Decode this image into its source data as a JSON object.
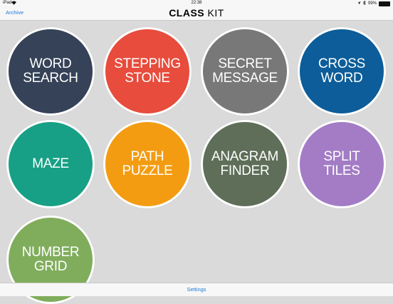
{
  "status": {
    "device": "iPad",
    "time": "22:38",
    "battery_text": "99%",
    "battery_level": 0.99
  },
  "nav": {
    "archive_label": "Archive",
    "title_bold": "CLASS",
    "title_light": "KIT"
  },
  "games": [
    {
      "label": "WORD\nSEARCH",
      "color": "#354257"
    },
    {
      "label": "STEPPING\nSTONE",
      "color": "#e74c3c"
    },
    {
      "label": "SECRET\nMESSAGE",
      "color": "#787878"
    },
    {
      "label": "CROSS\nWORD",
      "color": "#0c5d99"
    },
    {
      "label": "MAZE",
      "color": "#17a085"
    },
    {
      "label": "PATH\nPUZZLE",
      "color": "#f39c12"
    },
    {
      "label": "ANAGRAM\nFINDER",
      "color": "#5e6e58"
    },
    {
      "label": "SPLIT\nTILES",
      "color": "#a37cc5"
    },
    {
      "label": "NUMBER\nGRID",
      "color": "#80ad5c"
    }
  ],
  "bottom": {
    "settings_label": "Settings"
  },
  "colors": {
    "accent": "#1a7ad9",
    "background": "#dadada"
  }
}
